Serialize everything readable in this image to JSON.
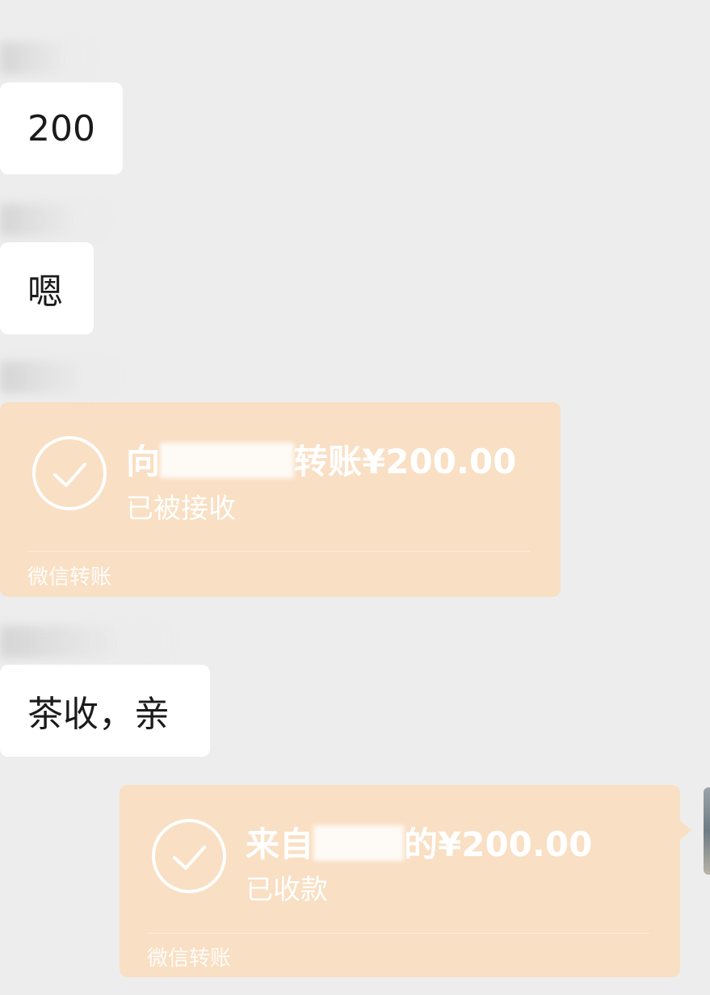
{
  "messages": [
    {
      "type": "text",
      "side": "left",
      "text": "200"
    },
    {
      "type": "text",
      "side": "left",
      "text": "嗯"
    },
    {
      "type": "transfer",
      "side": "left",
      "title_prefix": "向",
      "title_suffix": "转账¥200.00",
      "status": "已被接收",
      "footer": "微信转账"
    },
    {
      "type": "text",
      "side": "left",
      "text": "茶收，亲"
    },
    {
      "type": "transfer",
      "side": "right",
      "title_prefix": "来自",
      "title_suffix": "的¥200.00",
      "status": "已收款",
      "footer": "微信转账"
    }
  ],
  "colors": {
    "background": "#ededed",
    "bubble": "#ffffff",
    "transfer": "#f9dfc3",
    "text": "#1b1b1b"
  },
  "icons": {
    "transfer_status": "check-circle-icon"
  }
}
